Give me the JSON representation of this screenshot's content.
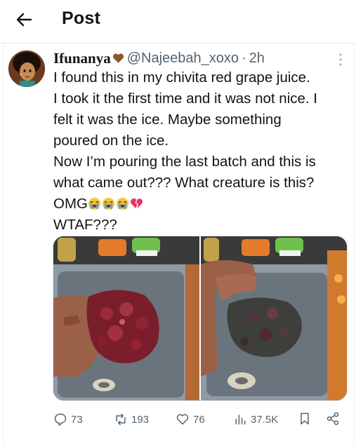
{
  "header": {
    "title": "Post"
  },
  "post": {
    "display_name": "Ifunanya",
    "handle": "@Najeebah_xoxo",
    "separator": "·",
    "time": "2h",
    "lines": [
      "I found this in my chivita red grape juice.",
      "I took it the first time and it was not nice. I",
      "felt it was the ice. Maybe something",
      "poured on the ice.",
      "Now I’m pouring the last batch and this is",
      "what came out??? What creature is this?",
      "OMG",
      "WTAF???"
    ],
    "emojis_after_omg": [
      "loudly-crying-face",
      "loudly-crying-face",
      "loudly-crying-face",
      "broken-heart"
    ],
    "name_emoji": "brown-heart"
  },
  "actions": {
    "replies": "73",
    "reposts": "193",
    "likes": "76",
    "views": "37.5K"
  },
  "colors": {
    "text": "#0f1419",
    "secondary": "#536471",
    "divider": "#e8eaec"
  }
}
